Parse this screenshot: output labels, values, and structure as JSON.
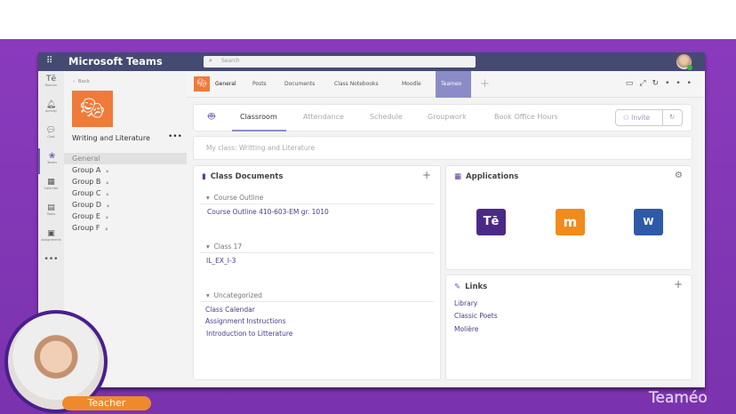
{
  "app": {
    "title": "Microsoft Teams",
    "search_placeholder": "Search"
  },
  "rail": [
    {
      "label": "Teacher",
      "icon": "teacher-icon"
    },
    {
      "label": "Activity",
      "icon": "bell-icon"
    },
    {
      "label": "Chat",
      "icon": "chat-icon"
    },
    {
      "label": "Teams",
      "icon": "teams-icon"
    },
    {
      "label": "Calendar",
      "icon": "calendar-icon"
    },
    {
      "label": "Tasks",
      "icon": "tasks-icon"
    },
    {
      "label": "Assignments",
      "icon": "bag-icon"
    }
  ],
  "team": {
    "back": "Back",
    "name": "Writing and Literature",
    "channels": [
      "General",
      "Group A",
      "Group B",
      "Group C",
      "Group D",
      "Group E",
      "Group F"
    ]
  },
  "tabs": [
    "General",
    "Posts",
    "Documents",
    "Class Notebooks",
    "Moodle",
    "Teameo"
  ],
  "classroom": {
    "tabs": [
      "Classroom",
      "Attendance",
      "Schedule",
      "Groupwork",
      "Book Office Hours"
    ],
    "invite": "Invite",
    "myclass": "My class: Writting and Literature"
  },
  "documents": {
    "title": "Class Documents",
    "sections": [
      {
        "name": "Course Outline",
        "items": [
          "Course Outline 410-603-EM gr. 1010"
        ]
      },
      {
        "name": "Class 17",
        "items": [
          "IL_EX_I-3"
        ]
      },
      {
        "name": "Uncategorized",
        "items": [
          "Class Calendar",
          "Assignment Instructions",
          "Introduction to Litterature"
        ]
      }
    ]
  },
  "applications": {
    "title": "Applications",
    "apps": [
      {
        "label": "Tē",
        "color": "#4b2a86"
      },
      {
        "label": "m",
        "color": "#f28a1c"
      },
      {
        "label": "W",
        "color": "#2f5aa8"
      }
    ]
  },
  "links": {
    "title": "Links",
    "items": [
      "Library",
      "Classic Poets",
      "Molière"
    ]
  },
  "overlay": {
    "role": "Teacher",
    "brand": "Teaméo"
  }
}
